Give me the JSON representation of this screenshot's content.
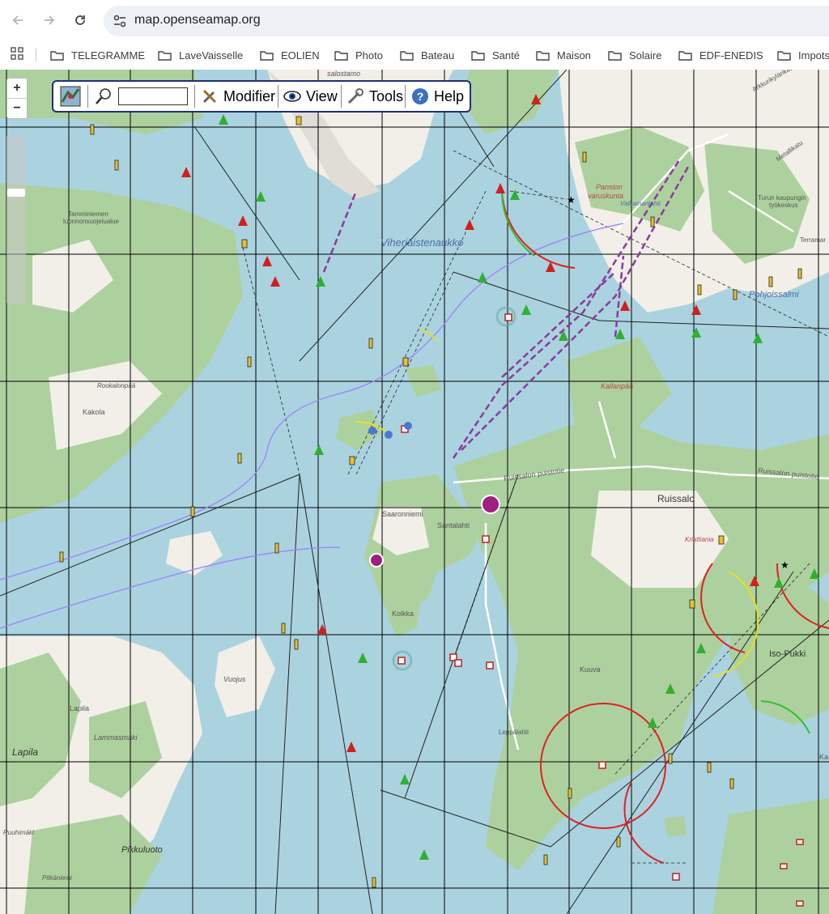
{
  "browser": {
    "url": "map.openseamap.org",
    "bookmarks": [
      "TELEGRAMME",
      "LaveVaisselle",
      "EOLIEN",
      "Photo",
      "Bateau",
      "Santé",
      "Maison",
      "Solaire",
      "EDF-ENEDIS",
      "Impots"
    ]
  },
  "map": {
    "zoom_in": "+",
    "zoom_out": "−",
    "toolbar": {
      "search_value": "",
      "modifier": "Modifier",
      "view": "View",
      "tools": "Tools",
      "help": "Help"
    },
    "labels": {
      "ruissalo": "Ruissalo",
      "saaronniemi": "Saaronniemi",
      "santalahti": "Santalahti",
      "kolkka": "Kolkka",
      "kakola": "Kakola",
      "lapila": "Lapila",
      "lapila_small": "Lapila",
      "lammasmaki": "Lammasmaki",
      "pikkuluoto": "Pikkuluoto",
      "vuojus": "Vuojus",
      "kuuva": "Kuuva",
      "isopukki": "Iso-Pukki",
      "pansion": "Pansion",
      "varuskunta": "varuskunta",
      "viheriaistenaukko": "Viheriäistenaukko",
      "pohjoissalmi": "Pohjoissalmi",
      "ruissalon_puistotie": "Ruissalon puistotie",
      "ruissalon_puistotie2": "Ruissalon puistotie",
      "kallanpaa": "Kallanpää",
      "tamminiemen1": "Tamminiemen",
      "tamminiemen2": "luonnonsuojelualue",
      "turun1": "Turun kaupungin",
      "turun2": "työkeskus",
      "rookalonpaa": "Rookalonpää",
      "metallikatu": "Metallikatu",
      "kriattiania": "Kriattiania",
      "leppalahti": "Leppälahti",
      "ruuhimaki": "Ruuhimäki",
      "pitkaniemi": "Pitkäniemi",
      "terramar": "Terramar",
      "valkamanlahti": "Valkamanlahti",
      "ka": "Ka",
      "arkkurikylanktu": "Arkkurikylänkatu",
      "salostamo": "salostamo"
    },
    "colors": {
      "water": "#aad3df",
      "land": "#f2efe9",
      "forest": "#add19e",
      "grid": "#000000",
      "purple_route": "#8a3aa0",
      "light_sector_red": "#e02020",
      "light_sector_green": "#30c030",
      "light_sector_yellow": "#e8e020"
    }
  }
}
